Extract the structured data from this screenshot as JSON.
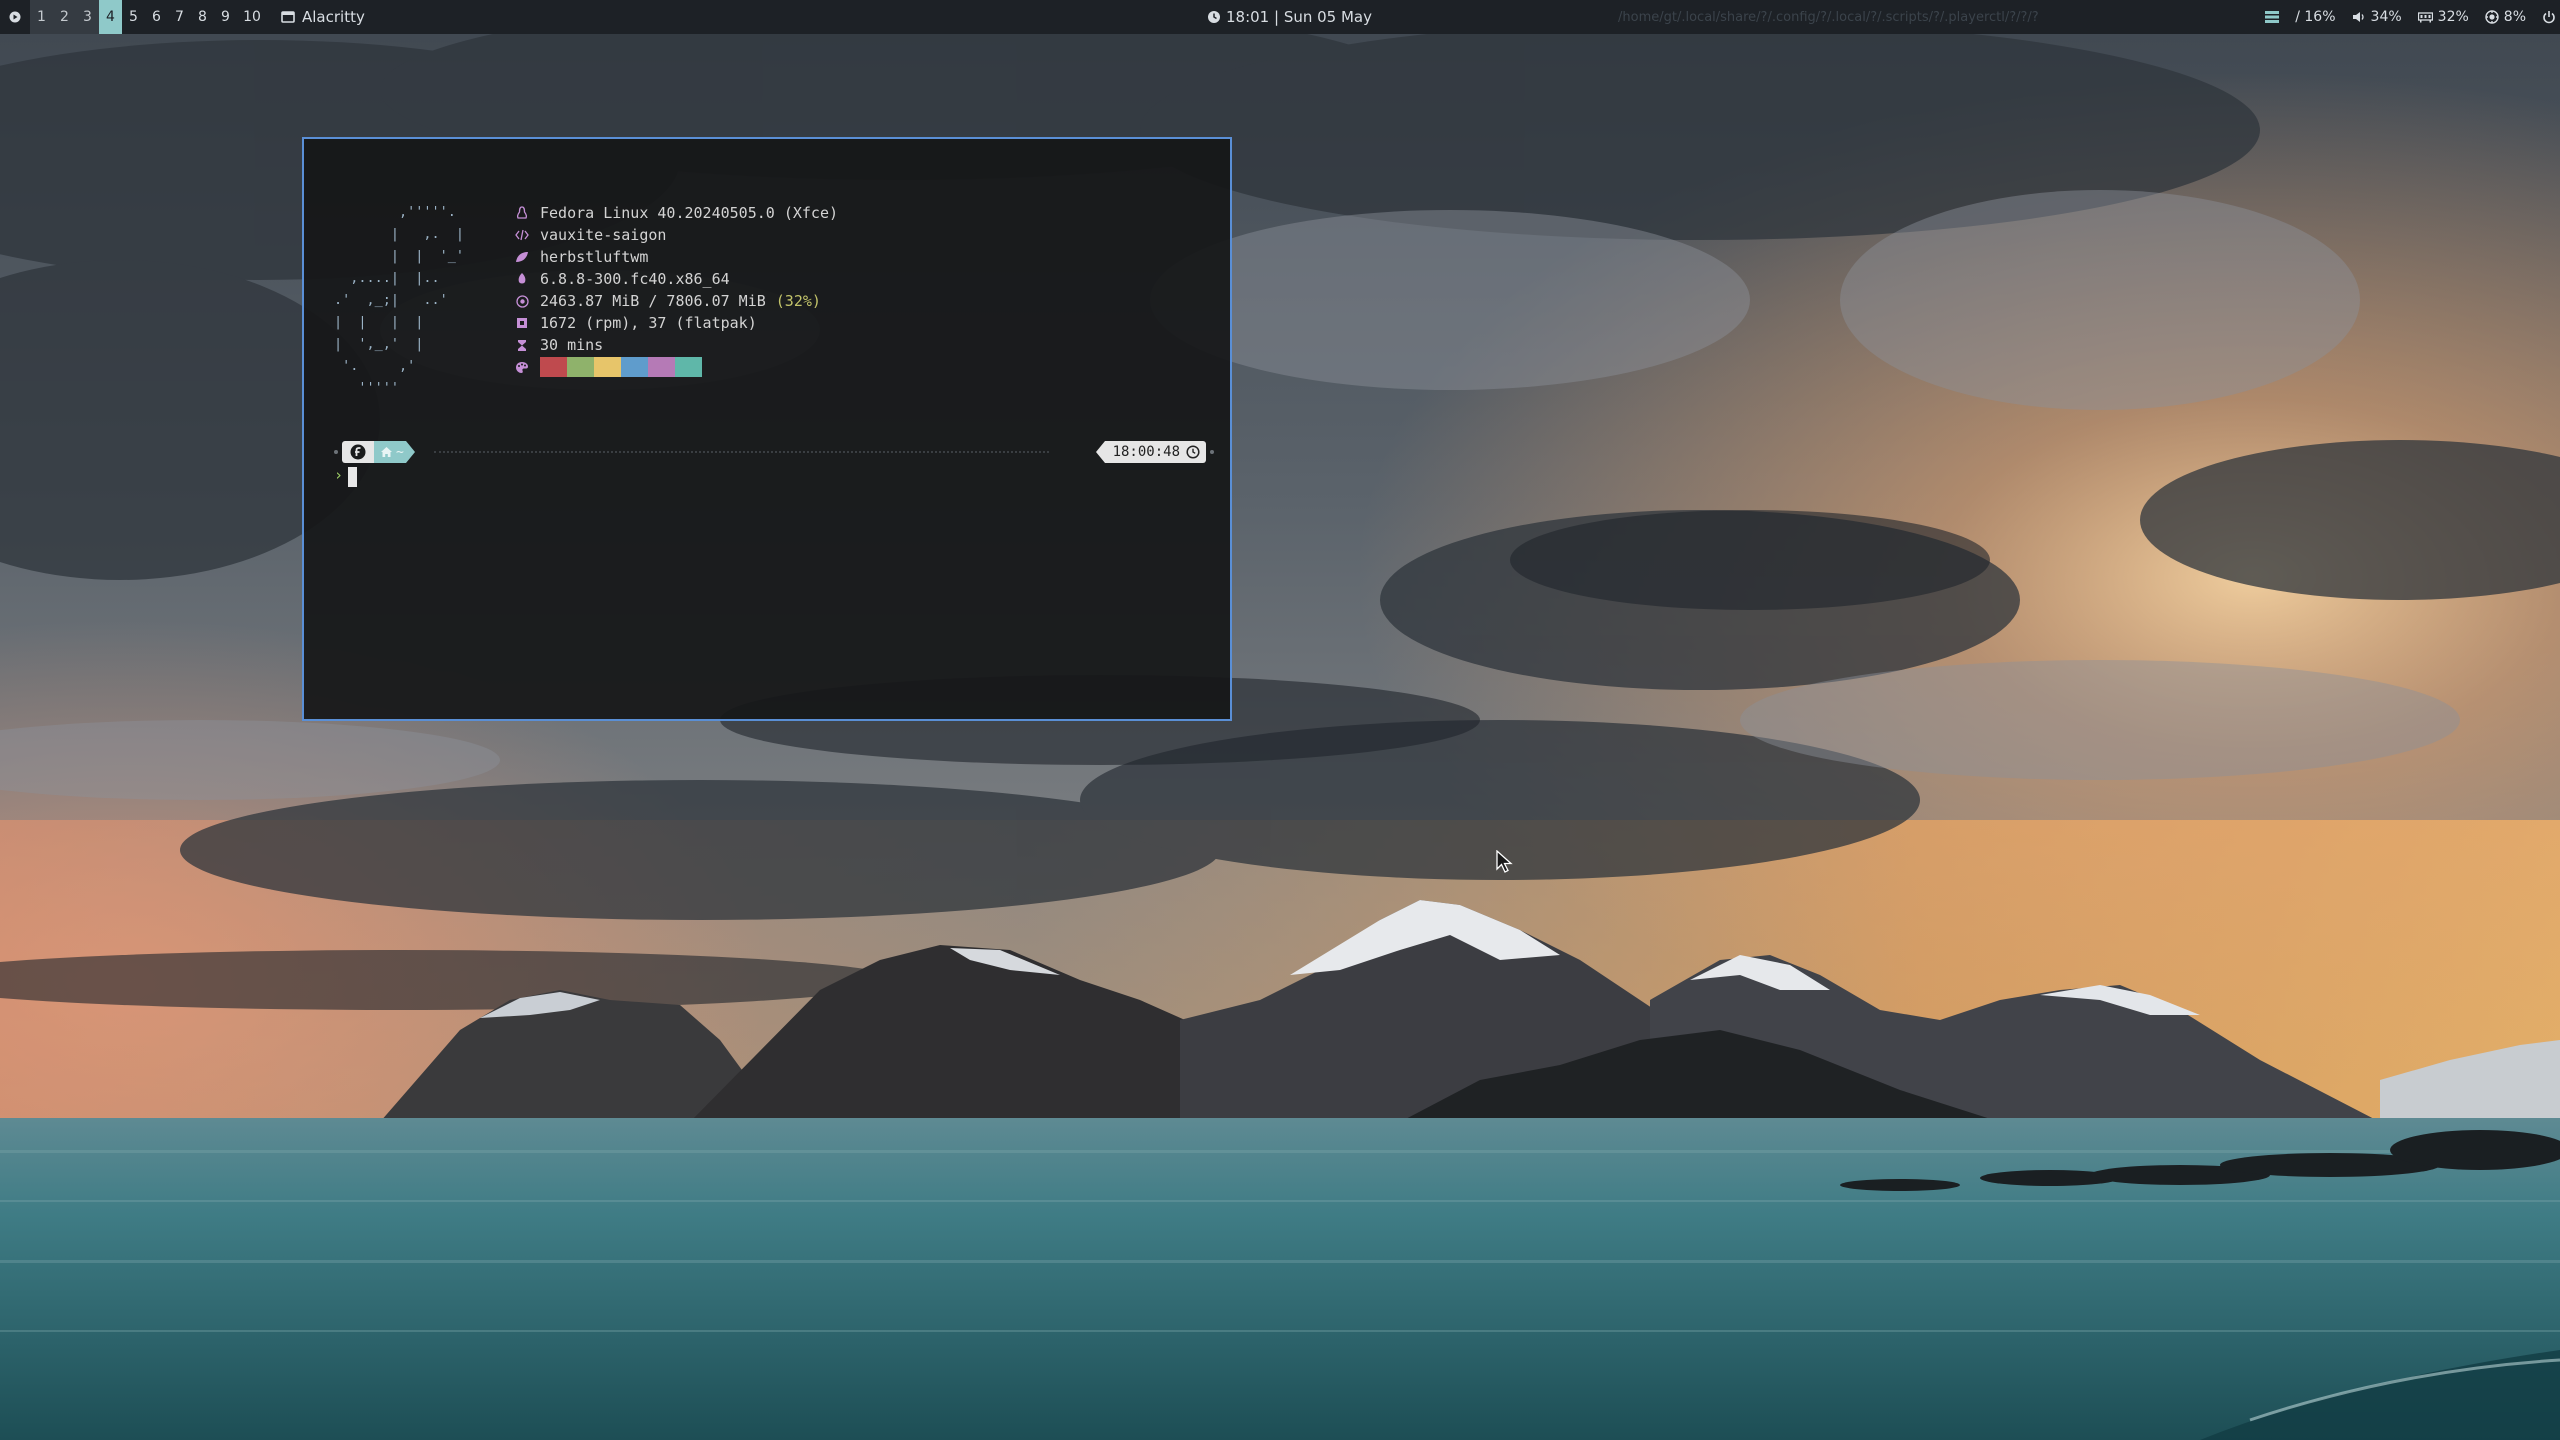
{
  "topbar": {
    "workspaces": [
      {
        "label": "1",
        "state": "visited"
      },
      {
        "label": "2",
        "state": "visited"
      },
      {
        "label": "3",
        "state": "visited"
      },
      {
        "label": "4",
        "state": "active"
      },
      {
        "label": "5",
        "state": "empty"
      },
      {
        "label": "6",
        "state": "empty"
      },
      {
        "label": "7",
        "state": "empty"
      },
      {
        "label": "8",
        "state": "empty"
      },
      {
        "label": "9",
        "state": "empty"
      },
      {
        "label": "10",
        "state": "empty"
      }
    ],
    "active_app": {
      "name": "Alacritty",
      "icon": "window-icon"
    },
    "clock": {
      "text": "18:01 | Sun 05 May",
      "icon": "clock-icon"
    },
    "window_path": "/home/gt/.local/share/?/.config/?/.local/?/.scripts/?/.playerctl/?/?/?",
    "tray": {
      "layout_icon": "layout-icon",
      "disk": "/ 16%",
      "volume": "34%",
      "volume_icon": "speaker-icon",
      "memory": "32%",
      "memory_icon": "memory-icon",
      "cpu": "8%",
      "cpu_icon": "cpu-icon",
      "power_icon": "power-icon"
    }
  },
  "terminal": {
    "ascii_logo": "        ,'''''.\n       |   ,.  |\n       |  |  '_'\n  ,....|  |..\n.'  ,_;|   ..'\n|  |   |  |\n|  ',_,'  |\n '.     ,'\n   '''''",
    "fetch": [
      {
        "icon": "linux-icon",
        "text": "Fedora Linux 40.20240505.0 (Xfce)"
      },
      {
        "icon": "code-icon",
        "text": "vauxite-saigon"
      },
      {
        "icon": "leaf-icon",
        "text": "herbstluftwm"
      },
      {
        "icon": "gear-icon",
        "text": "6.8.8-300.fc40.x86_64"
      },
      {
        "icon": "memory-icon",
        "text": "2463.87 MiB / 7806.07 MiB",
        "pct": "(32%)"
      },
      {
        "icon": "package-icon",
        "text": "1672 (rpm), 37 (flatpak)"
      },
      {
        "icon": "hourglass-icon",
        "text": "30 mins"
      }
    ],
    "palette": {
      "icon": "palette-icon",
      "colors": [
        "#bf4a4e",
        "#8fb26b",
        "#e7c56a",
        "#5f9ccc",
        "#b57ab6",
        "#5fb7a9"
      ]
    },
    "prompt": {
      "os_icon": "fedora-icon",
      "dir_icon": "home-icon",
      "dir": "~",
      "time": "18:00:48",
      "time_icon": "clock-icon",
      "char": "›"
    }
  }
}
